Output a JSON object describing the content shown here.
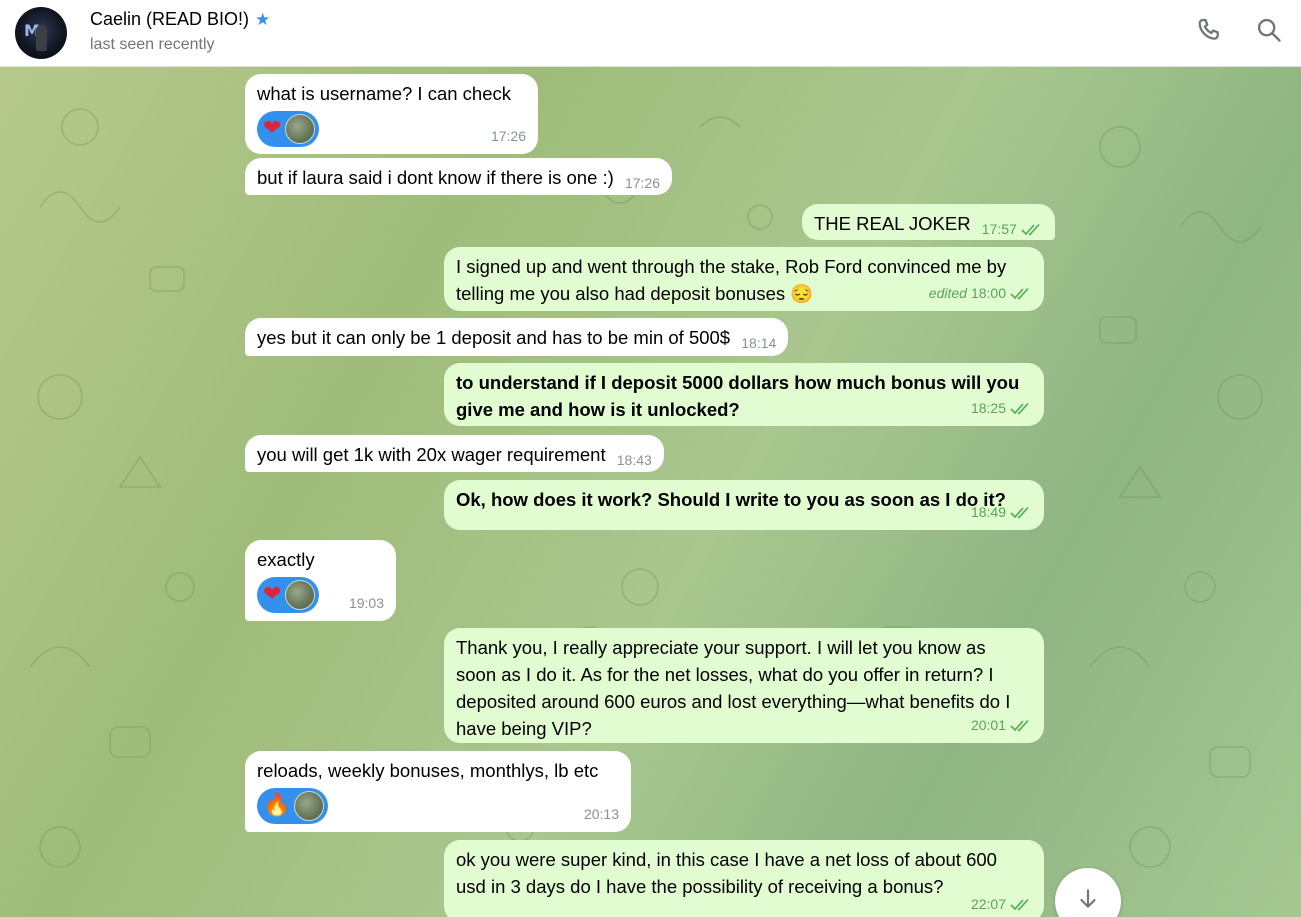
{
  "header": {
    "contact_name": "Caelin (READ BIO!)",
    "status": "last seen recently",
    "verified_icon": "star-icon",
    "actions": [
      {
        "name": "call",
        "icon": "phone-icon"
      },
      {
        "name": "search",
        "icon": "search-icon"
      }
    ]
  },
  "messages": [
    {
      "dir": "in",
      "text": "what is username? I can check",
      "time": "17:26",
      "reactions": [
        "❤️",
        "avatar"
      ]
    },
    {
      "dir": "in",
      "text": "but if laura said i dont know if there is one :)",
      "time": "17:26"
    },
    {
      "dir": "out",
      "text": "THE REAL JOKER",
      "time": "17:57",
      "read": true
    },
    {
      "dir": "out",
      "text": "I signed up and went through the stake, Rob Ford convinced me by telling me you also had deposit bonuses 😔",
      "time": "18:00",
      "edited_label": "edited",
      "read": true
    },
    {
      "dir": "in",
      "text": "yes but it can only be 1 deposit and has to be min of 500$",
      "time": "18:14"
    },
    {
      "dir": "out",
      "text": "to understand if I deposit 5000 dollars how much bonus will you give me and how is it unlocked?",
      "time": "18:25",
      "read": true
    },
    {
      "dir": "in",
      "text": "you will get 1k with 20x wager requirement",
      "time": "18:43"
    },
    {
      "dir": "out",
      "text": "Ok, how does it work? Should I write to you as soon as I do it?",
      "time": "18:49",
      "read": true
    },
    {
      "dir": "in",
      "text": "exactly",
      "time": "19:03",
      "reactions": [
        "❤️",
        "avatar"
      ]
    },
    {
      "dir": "out",
      "text": "Thank you, I really appreciate your support. I will let you know as soon as I do it. As for the net losses, what do you offer in return? I deposited around 600 euros and lost everything—what benefits do I have being VIP?",
      "time": "20:01",
      "read": true
    },
    {
      "dir": "in",
      "text": "reloads, weekly bonuses, monthlys, lb etc",
      "time": "20:13",
      "reactions": [
        "🔥",
        "avatar"
      ]
    },
    {
      "dir": "out",
      "text": "ok you were super kind, in this case I have a net loss of about 600 usd in 3 days do I have the possibility of receiving a bonus?",
      "time": "22:07",
      "read": true
    }
  ],
  "colors": {
    "incoming_bubble": "#ffffff",
    "outgoing_bubble": "#e0fcd0",
    "accent": "#3390ec",
    "read_check": "#4fae4e"
  },
  "scroll_button_icon": "arrow-down-icon"
}
